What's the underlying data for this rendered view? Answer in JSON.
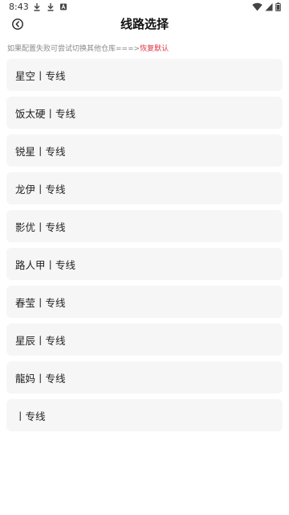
{
  "status": {
    "time": "8:43"
  },
  "header": {
    "title": "线路选择"
  },
  "notice": {
    "text": "如果配置失败可尝试切换其他仓库===>",
    "link": "恢复默认"
  },
  "routes": [
    {
      "label": "星空丨专线"
    },
    {
      "label": "饭太硬丨专线"
    },
    {
      "label": "锐星丨专线"
    },
    {
      "label": "龙伊丨专线"
    },
    {
      "label": "影优丨专线"
    },
    {
      "label": "路人甲丨专线"
    },
    {
      "label": "春莹丨专线"
    },
    {
      "label": "星辰丨专线"
    },
    {
      "label": "龍妈丨专线"
    },
    {
      "label": "丨专线"
    }
  ],
  "colors": {
    "accent": "#e0364a",
    "card": "#f6f6f6",
    "muted": "#8a8a8a"
  }
}
